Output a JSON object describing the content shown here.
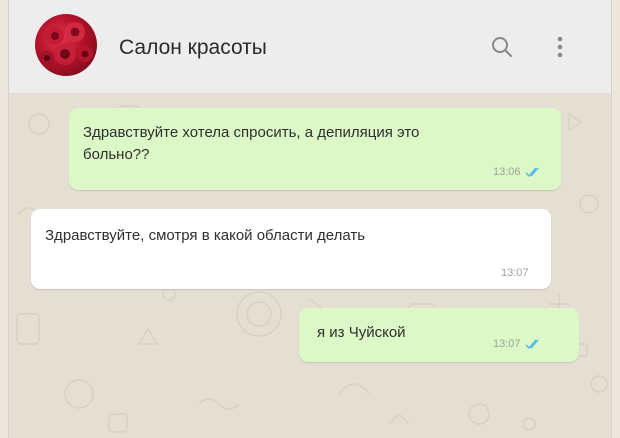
{
  "header": {
    "title": "Салон красоты",
    "avatar": "rose-photo-avatar",
    "search_icon": "search-icon",
    "menu_icon": "kebab-menu-icon"
  },
  "messages": [
    {
      "direction": "outgoing",
      "line1": "Здравствуйте хотела спросить, а депиляция это",
      "line2": "больно??",
      "time": "13:06",
      "status_icon": "double-check-read-icon"
    },
    {
      "direction": "incoming",
      "line1": "Здравствуйте, смотря в какой области делать",
      "time": "13:07"
    },
    {
      "direction": "outgoing",
      "line1": "я из Чуйской",
      "time": "13:07",
      "status_icon": "double-check-read-icon"
    }
  ],
  "colors": {
    "outgoing_bubble": "#dcf8c6",
    "incoming_bubble": "#ffffff",
    "chat_background": "#e4ded3",
    "header_background": "#ededed",
    "read_ticks": "#4fb6ec"
  }
}
